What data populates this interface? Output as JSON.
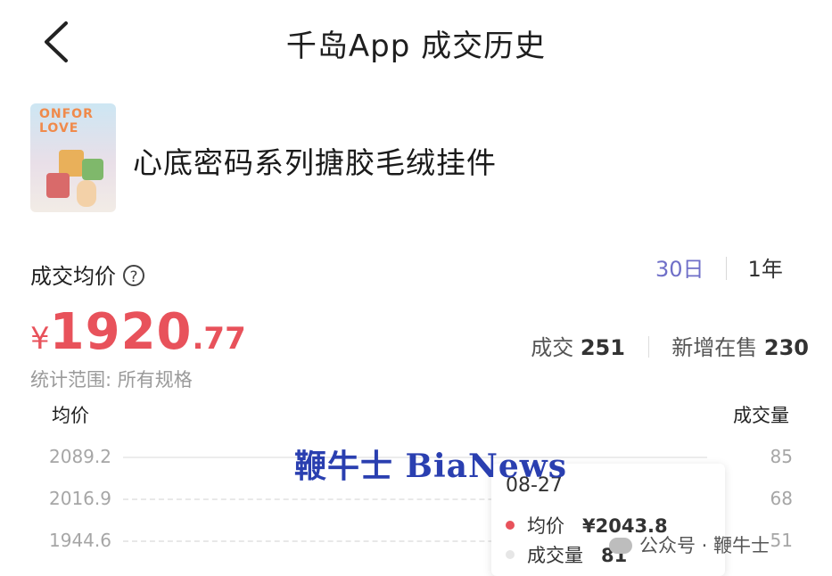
{
  "header": {
    "title": "千岛App 成交历史"
  },
  "product": {
    "name": "心底密码系列搪胶毛绒挂件",
    "thumb_text": "ONFOR LOVE"
  },
  "summary": {
    "avg_label": "成交均价",
    "help_icon": "?",
    "range_tabs": [
      "30日",
      "1年"
    ],
    "price_currency": "¥",
    "price_int": "1920",
    "price_dec": ".77",
    "deals_label": "成交",
    "deals_value": "251",
    "new_label": "新增在售",
    "new_value": "230",
    "scope": "统计范围: 所有规格"
  },
  "chart_data": {
    "type": "line",
    "left_axis_label": "均价",
    "right_axis_label": "成交量",
    "left_ticks": [
      "2089.2",
      "2016.9",
      "1944.6"
    ],
    "right_ticks": [
      "85",
      "68",
      "51"
    ],
    "tooltip": {
      "date": "08-27",
      "avg_label": "均价",
      "avg_value": "¥2043.8",
      "vol_label": "成交量",
      "vol_value": "81"
    }
  },
  "watermark": "鞭牛士 BiaNews",
  "account": {
    "label": "公众号 · 鞭牛士"
  },
  "colors": {
    "accent": "#e8525b",
    "tab_active": "#6f6fc8",
    "watermark": "#2a3fb0"
  }
}
